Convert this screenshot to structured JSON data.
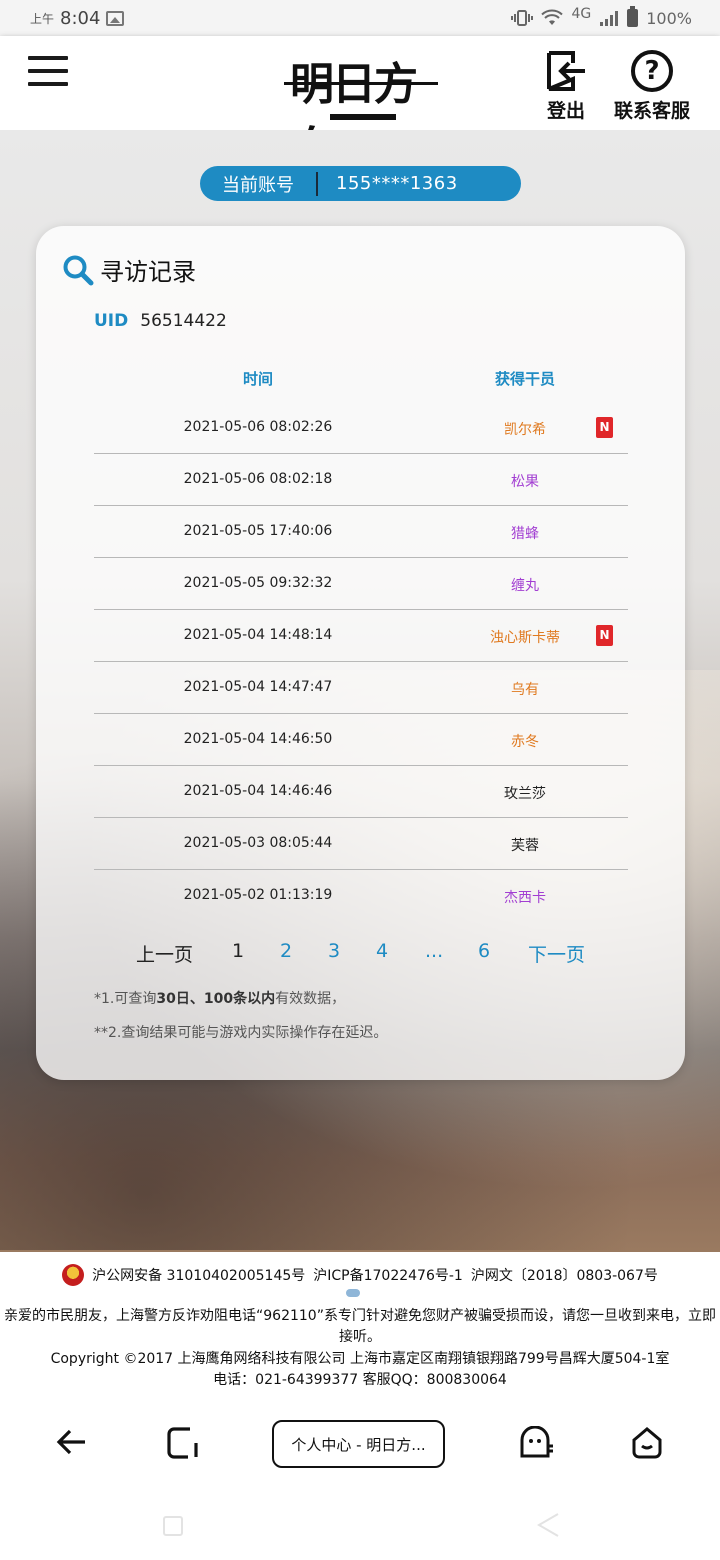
{
  "status_bar": {
    "ampm": "上午",
    "time": "8:04",
    "network": "4G",
    "battery": "100%",
    "icons": [
      "image-icon",
      "vibrate-icon",
      "wifi-icon",
      "signal-icon",
      "battery-icon"
    ]
  },
  "header": {
    "logo_text": "明日方舟",
    "logout_label": "登出",
    "support_label": "联系客服"
  },
  "account": {
    "label": "当前账号",
    "value": "155****1363"
  },
  "records": {
    "title": "寻访记录",
    "uid_label": "UID",
    "uid_value": "56514422",
    "columns": [
      "时间",
      "获得干员"
    ],
    "rows": [
      {
        "time": "2021-05-06 08:02:26",
        "operator": "凯尔希",
        "new": "N",
        "rarity_color": "#e07a20"
      },
      {
        "time": "2021-05-06 08:02:18",
        "operator": "松果",
        "new": "",
        "rarity_color": "#a23ed2"
      },
      {
        "time": "2021-05-05 17:40:06",
        "operator": "猎蜂",
        "new": "",
        "rarity_color": "#a23ed2"
      },
      {
        "time": "2021-05-05 09:32:32",
        "operator": "缠丸",
        "new": "",
        "rarity_color": "#a23ed2"
      },
      {
        "time": "2021-05-04 14:48:14",
        "operator": "浊心斯卡蒂",
        "new": "N",
        "rarity_color": "#e07a20"
      },
      {
        "time": "2021-05-04 14:47:47",
        "operator": "乌有",
        "new": "",
        "rarity_color": "#e07a20"
      },
      {
        "time": "2021-05-04 14:46:50",
        "operator": "赤冬",
        "new": "",
        "rarity_color": "#e07a20"
      },
      {
        "time": "2021-05-04 14:46:46",
        "operator": "玫兰莎",
        "new": "",
        "rarity_color": "#222222"
      },
      {
        "time": "2021-05-03 08:05:44",
        "operator": "芙蓉",
        "new": "",
        "rarity_color": "#222222"
      },
      {
        "time": "2021-05-02 01:13:19",
        "operator": "杰西卡",
        "new": "",
        "rarity_color": "#a23ed2"
      }
    ],
    "pagination": {
      "prev": "上一页",
      "pages": [
        "1",
        "2",
        "3",
        "4",
        "...",
        "6"
      ],
      "current": "1",
      "next": "下一页"
    },
    "note1": {
      "prefix": "*1.可查询",
      "bold": "30日、100条以内",
      "suffix": "有效数据，"
    },
    "note2": "**2.查询结果可能与游戏内实际操作存在延迟。"
  },
  "footer": {
    "police_record": "沪公网安备 31010402005145号",
    "icp": "沪ICP备17022476号-1",
    "culture": "沪网文〔2018〕0803-067号",
    "notice": "亲爱的市民朋友，上海警方反诈劝阻电话“962110”系专门针对避免您财产被骗受损而设，请您一旦收到来电，立即接听。",
    "copyright": "Copyright ©2017 上海鹰角网络科技有限公司 上海市嘉定区南翔镇银翔路799号昌辉大厦504-1室",
    "contact": "电话：021-64399377 客服QQ：800830064"
  },
  "browser": {
    "tab_title": "个人中心 - 明日方..."
  },
  "colors": {
    "accent": "#1e8bc3",
    "six_star": "#e07a20",
    "five_star": "#a23ed2",
    "new_badge": "#e0272a"
  }
}
